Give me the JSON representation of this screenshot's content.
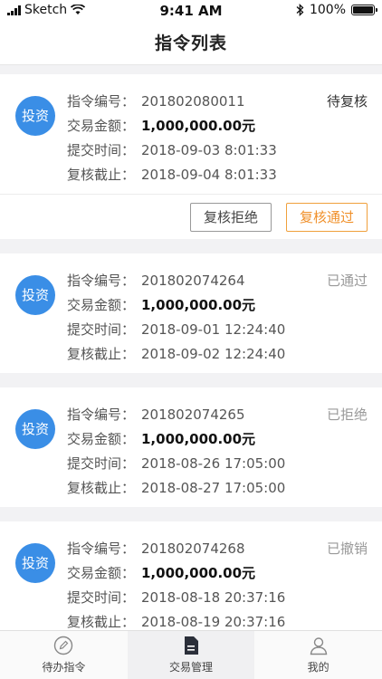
{
  "status_bar": {
    "carrier": "Sketch",
    "time": "9:41 AM",
    "battery": "100%"
  },
  "nav": {
    "title": "指令列表"
  },
  "labels": {
    "id": "指令编号：",
    "amount": "交易金额：",
    "submit_time": "提交时间：",
    "deadline": "复核截止："
  },
  "orders": [
    {
      "badge": "投资",
      "id": "201802080011",
      "amount": "1,000,000.00元",
      "submit_time": "2018-09-03   8:01:33",
      "deadline": "2018-09-04   8:01:33",
      "status": "待复核"
    },
    {
      "badge": "投资",
      "id": "201802074264",
      "amount": "1,000,000.00元",
      "submit_time": "2018-09-01   12:24:40",
      "deadline": "2018-09-02   12:24:40",
      "status": "已通过"
    },
    {
      "badge": "投资",
      "id": "201802074265",
      "amount": "1,000,000.00元",
      "submit_time": "2018-08-26   17:05:00",
      "deadline": "2018-08-27   17:05:00",
      "status": "已拒绝"
    },
    {
      "badge": "投资",
      "id": "201802074268",
      "amount": "1,000,000.00元",
      "submit_time": "2018-08-18   20:37:16",
      "deadline": "2018-08-19   20:37:16",
      "status": "已撤销"
    }
  ],
  "actions": {
    "reject": "复核拒绝",
    "approve": "复核通过"
  },
  "tabs": [
    {
      "label": "待办指令",
      "icon": "edit-circle-icon"
    },
    {
      "label": "交易管理",
      "icon": "document-icon"
    },
    {
      "label": "我的",
      "icon": "user-icon"
    }
  ],
  "colors": {
    "accent_blue": "#3a8ee6",
    "approve_orange": "#f0902a"
  }
}
